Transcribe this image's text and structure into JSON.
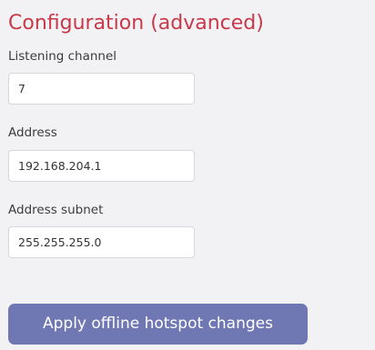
{
  "config": {
    "title": "Configuration (advanced)",
    "title_color": "#c8394a",
    "fields": [
      {
        "label": "Listening channel",
        "value": "7"
      },
      {
        "label": "Address",
        "value": "192.168.204.1"
      },
      {
        "label": "Address subnet",
        "value": "255.255.255.0"
      }
    ],
    "apply_label": "Apply offline hotspot changes",
    "apply_color": "#7078b4"
  }
}
